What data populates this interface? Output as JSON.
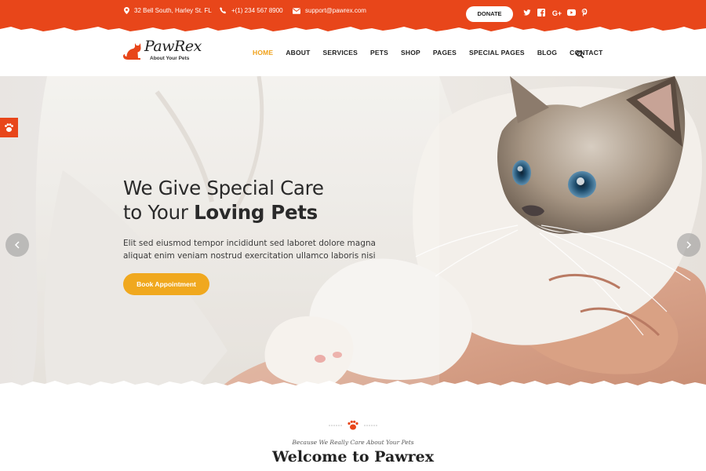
{
  "topbar": {
    "address": "32 Bell South, Harley St. FL",
    "phone": "+(1) 234 567 8900",
    "email": "support@pawrex.com",
    "donate_label": "DONATE",
    "social_icons": [
      "twitter-icon",
      "facebook-icon",
      "google-plus-icon",
      "youtube-icon",
      "pinterest-icon"
    ],
    "accent_color": "#e8461a"
  },
  "header": {
    "logo_text": "PawRex",
    "logo_tagline": "About Your Pets",
    "nav": [
      {
        "label": "HOME",
        "active": true
      },
      {
        "label": "ABOUT",
        "active": false
      },
      {
        "label": "SERVICES",
        "active": false
      },
      {
        "label": "PETS",
        "active": false
      },
      {
        "label": "SHOP",
        "active": false
      },
      {
        "label": "PAGES",
        "active": false
      },
      {
        "label": "SPECIAL PAGES",
        "active": false
      },
      {
        "label": "BLOG",
        "active": false
      },
      {
        "label": "CONTACT",
        "active": false
      }
    ],
    "active_color": "#f0a11a"
  },
  "hero": {
    "title_line1": "We Give Special Care",
    "title_line2_prefix": "to Your ",
    "title_line2_bold": "Loving Pets",
    "text": "Elit sed eiusmod tempor incididunt sed laboret dolore magna aliquat enim veniam nostrud exercitation ullamco laboris nisi",
    "button_label": "Book Appointment",
    "button_color": "#f0a81e"
  },
  "welcome": {
    "subtitle": "Because We Really Care About Your Pets",
    "title": "Welcome to Pawrex"
  }
}
